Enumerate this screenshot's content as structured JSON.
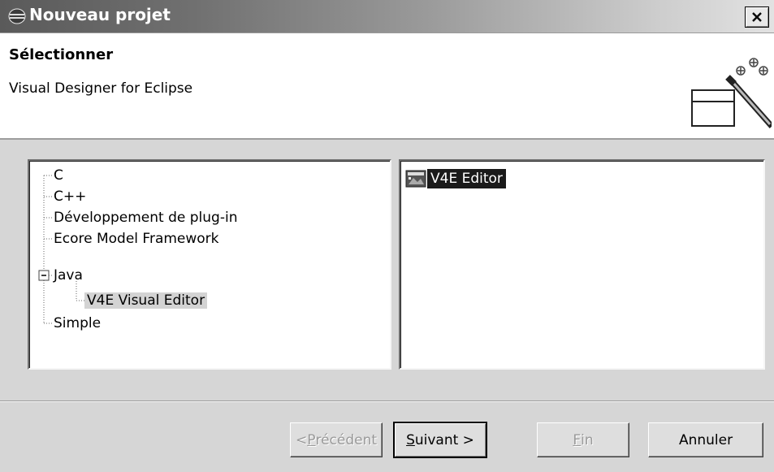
{
  "window": {
    "title": "Nouveau projet",
    "icon": "eclipse-app-icon",
    "close_icon": "close-icon"
  },
  "header": {
    "title": "Sélectionner",
    "description": "Visual Designer for Eclipse",
    "banner_icon": "wizard-banner-icon"
  },
  "tree": {
    "items": [
      {
        "label": "C",
        "level": 0
      },
      {
        "label": "C++",
        "level": 0
      },
      {
        "label": "Développement de plug-in",
        "level": 0
      },
      {
        "label": "Ecore Model Framework",
        "level": 0
      },
      {
        "label": "Java",
        "level": 0,
        "expanded": true
      },
      {
        "label": "V4E Visual Editor",
        "level": 1,
        "selected": true
      },
      {
        "label": "Simple",
        "level": 0
      }
    ]
  },
  "list": {
    "items": [
      {
        "label": "V4E Editor",
        "selected": true,
        "icon": "v4e-editor-icon"
      }
    ]
  },
  "buttons": {
    "back": {
      "pre": "< ",
      "mnemonic": "P",
      "rest": "récédent",
      "enabled": false
    },
    "next": {
      "pre": "",
      "mnemonic": "S",
      "rest": "uivant >",
      "enabled": true
    },
    "finish": {
      "pre": "",
      "mnemonic": "F",
      "rest": "in",
      "enabled": false
    },
    "cancel": {
      "label": "Annuler",
      "enabled": true
    }
  }
}
